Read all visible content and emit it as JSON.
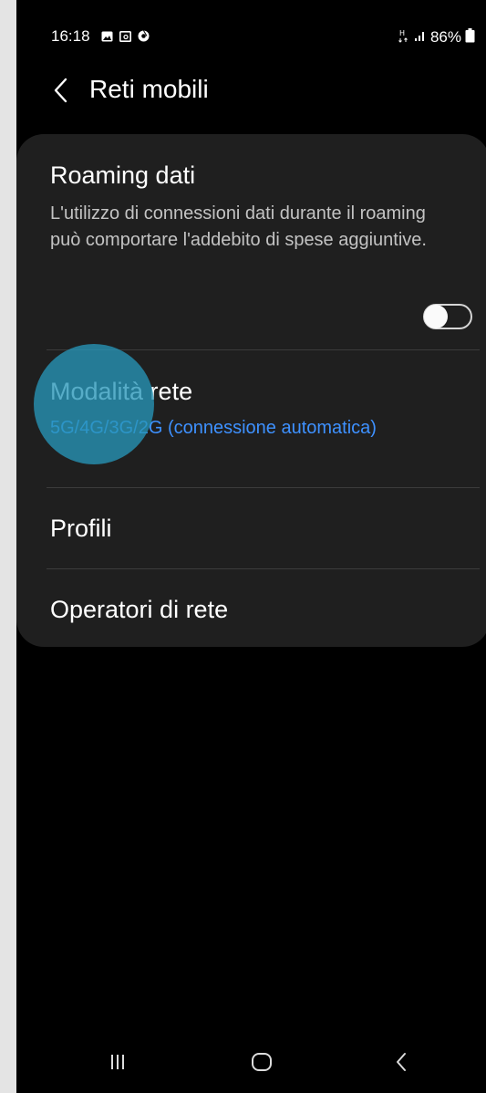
{
  "status_bar": {
    "time": "16:18",
    "left_icons": [
      "gallery-icon",
      "screenshot-icon",
      "chrome-icon"
    ],
    "network_label": "H",
    "battery_percent": "86%"
  },
  "header": {
    "title": "Reti mobili"
  },
  "settings": {
    "roaming": {
      "title": "Roaming dati",
      "description": "L'utilizzo di connessioni dati durante il roaming può comportare l'addebito di spese aggiuntive.",
      "enabled": false
    },
    "network_mode": {
      "title": "Modalità rete",
      "value": "5G/4G/3G/2G (connessione automatica)"
    },
    "profiles": {
      "title": "Profili"
    },
    "operators": {
      "title": "Operatori di rete"
    }
  },
  "colors": {
    "accent": "#3e91ff",
    "card_bg": "#1f1f1f",
    "screen_bg": "#000000",
    "touch_ripple": "#2896b9"
  }
}
